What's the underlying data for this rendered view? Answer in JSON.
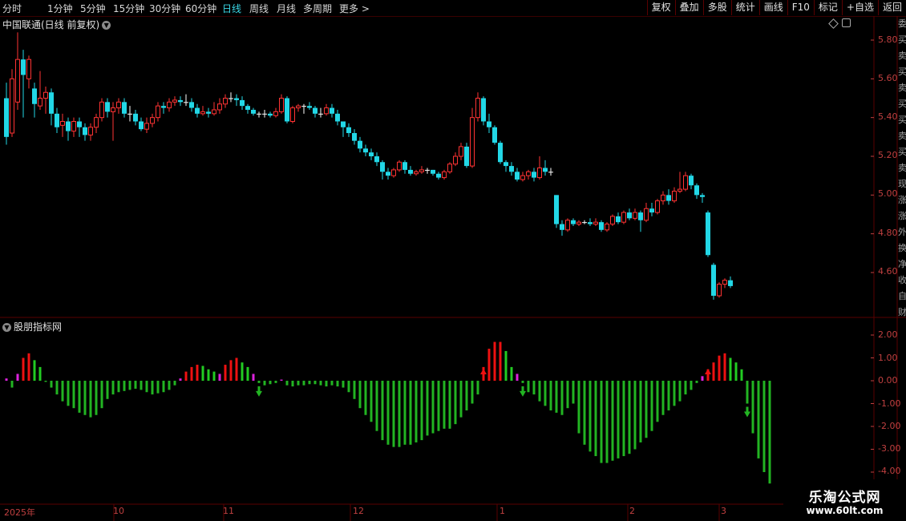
{
  "toolbar": {
    "periods": [
      "分时",
      "1分钟",
      "5分钟",
      "15分钟",
      "30分钟",
      "60分钟",
      "日线",
      "周线",
      "月线",
      "多周期",
      "更多 >"
    ],
    "active_period": "日线",
    "tools": [
      "复权",
      "叠加",
      "多股",
      "统计",
      "画线",
      "F10",
      "标记",
      "+自选",
      "返回"
    ]
  },
  "main_panel": {
    "title": "中国联通(日线 前复权)",
    "price_labels": [
      "5.80",
      "5.60",
      "5.40",
      "5.20",
      "5.00",
      "4.80",
      "4.60"
    ]
  },
  "indicator_panel": {
    "title": "股朋指标网",
    "value_labels": [
      "2.00",
      "1.00",
      "0.00",
      "-1.00",
      "-2.00",
      "-3.00",
      "-4.00"
    ]
  },
  "time_axis": [
    "2025年",
    "10",
    "11",
    "12",
    "1",
    "2",
    "3"
  ],
  "right_strip": [
    "委",
    "买",
    "卖",
    "买",
    "卖",
    "买",
    "买",
    "卖",
    "买",
    "卖",
    "现",
    "涨",
    "涨",
    "外",
    "换",
    "净",
    "收",
    "自",
    "财"
  ],
  "watermark": {
    "line1": "乐淘公式网",
    "line2": "www.60lt.com"
  },
  "colors": {
    "up": "#ff3333",
    "down": "#22d7e6",
    "flat": "#ffffff",
    "positive_bar": "#ee1111",
    "weak_positive_bar": "#22cc22",
    "negative_bar": "#22b422",
    "magenta_bar": "#dd22dd",
    "grid": "#5a0000",
    "axis_text": "#c04040",
    "active": "#3ad7e6"
  },
  "chart_data": [
    {
      "type": "candlestick",
      "title": "中国联通(日线 前复权)",
      "ylim": [
        4.42,
        5.92
      ],
      "candles": [
        [
          5.5,
          5.3,
          5.58,
          5.26
        ],
        [
          5.32,
          5.6,
          5.65,
          5.3
        ],
        [
          5.48,
          5.7,
          5.84,
          5.44
        ],
        [
          5.7,
          5.62,
          5.75,
          5.4
        ],
        [
          5.6,
          5.7,
          5.72,
          5.55
        ],
        [
          5.55,
          5.47,
          5.58,
          5.4
        ],
        [
          5.46,
          5.5,
          5.64,
          5.44
        ],
        [
          5.5,
          5.53,
          5.56,
          5.42
        ],
        [
          5.53,
          5.42,
          5.55,
          5.36
        ],
        [
          5.42,
          5.35,
          5.45,
          5.32
        ],
        [
          5.36,
          5.38,
          5.42,
          5.3
        ],
        [
          5.38,
          5.33,
          5.4,
          5.28
        ],
        [
          5.33,
          5.38,
          5.4,
          5.3
        ],
        [
          5.38,
          5.35,
          5.4,
          5.3
        ],
        [
          5.35,
          5.31,
          5.37,
          5.28
        ],
        [
          5.31,
          5.35,
          5.37,
          5.28
        ],
        [
          5.35,
          5.4,
          5.42,
          5.32
        ],
        [
          5.4,
          5.48,
          5.5,
          5.38
        ],
        [
          5.48,
          5.43,
          5.5,
          5.4
        ],
        [
          5.43,
          5.45,
          5.48,
          5.28
        ],
        [
          5.45,
          5.48,
          5.5,
          5.42
        ],
        [
          5.48,
          5.42,
          5.5,
          5.4
        ],
        [
          5.42,
          5.42,
          5.46,
          5.38
        ],
        [
          5.42,
          5.38,
          5.44,
          5.36
        ],
        [
          5.38,
          5.34,
          5.4,
          5.33
        ],
        [
          5.34,
          5.37,
          5.4,
          5.32
        ],
        [
          5.37,
          5.4,
          5.42,
          5.35
        ],
        [
          5.4,
          5.46,
          5.48,
          5.38
        ],
        [
          5.46,
          5.45,
          5.48,
          5.42
        ],
        [
          5.45,
          5.48,
          5.5,
          5.43
        ],
        [
          5.48,
          5.49,
          5.51,
          5.46
        ],
        [
          5.49,
          5.48,
          5.51,
          5.46
        ],
        [
          5.48,
          5.48,
          5.52,
          5.46
        ],
        [
          5.48,
          5.45,
          5.5,
          5.43
        ],
        [
          5.45,
          5.42,
          5.47,
          5.4
        ],
        [
          5.42,
          5.43,
          5.46,
          5.41
        ],
        [
          5.43,
          5.42,
          5.45,
          5.4
        ],
        [
          5.42,
          5.44,
          5.48,
          5.41
        ],
        [
          5.44,
          5.47,
          5.5,
          5.42
        ],
        [
          5.47,
          5.5,
          5.52,
          5.45
        ],
        [
          5.5,
          5.5,
          5.53,
          5.48
        ],
        [
          5.5,
          5.49,
          5.52,
          5.46
        ],
        [
          5.49,
          5.46,
          5.51,
          5.44
        ],
        [
          5.46,
          5.44,
          5.47,
          5.42
        ],
        [
          5.44,
          5.42,
          5.45,
          5.41
        ],
        [
          5.42,
          5.42,
          5.43,
          5.4
        ],
        [
          5.42,
          5.42,
          5.44,
          5.4
        ],
        [
          5.42,
          5.41,
          5.43,
          5.4
        ],
        [
          5.41,
          5.43,
          5.45,
          5.4
        ],
        [
          5.43,
          5.5,
          5.52,
          5.42
        ],
        [
          5.5,
          5.38,
          5.51,
          5.37
        ],
        [
          5.38,
          5.45,
          5.46,
          5.37
        ],
        [
          5.45,
          5.46,
          5.47,
          5.43
        ],
        [
          5.46,
          5.46,
          5.47,
          5.42
        ],
        [
          5.46,
          5.45,
          5.48,
          5.44
        ],
        [
          5.45,
          5.42,
          5.46,
          5.4
        ],
        [
          5.42,
          5.42,
          5.45,
          5.4
        ],
        [
          5.42,
          5.45,
          5.47,
          5.41
        ],
        [
          5.45,
          5.42,
          5.47,
          5.4
        ],
        [
          5.42,
          5.38,
          5.44,
          5.36
        ],
        [
          5.38,
          5.35,
          5.38,
          5.3
        ],
        [
          5.35,
          5.32,
          5.37,
          5.3
        ],
        [
          5.32,
          5.28,
          5.34,
          5.26
        ],
        [
          5.28,
          5.24,
          5.3,
          5.22
        ],
        [
          5.24,
          5.22,
          5.26,
          5.2
        ],
        [
          5.22,
          5.2,
          5.24,
          5.18
        ],
        [
          5.2,
          5.17,
          5.22,
          5.15
        ],
        [
          5.17,
          5.12,
          5.18,
          5.08
        ],
        [
          5.12,
          5.1,
          5.14,
          5.08
        ],
        [
          5.1,
          5.13,
          5.14,
          5.09
        ],
        [
          5.13,
          5.17,
          5.18,
          5.12
        ],
        [
          5.17,
          5.13,
          5.18,
          5.11
        ],
        [
          5.13,
          5.11,
          5.15,
          5.1
        ],
        [
          5.11,
          5.12,
          5.13,
          5.1
        ],
        [
          5.12,
          5.13,
          5.15,
          5.11
        ],
        [
          5.13,
          5.13,
          5.14,
          5.11
        ],
        [
          5.13,
          5.11,
          5.13,
          5.1
        ],
        [
          5.11,
          5.09,
          5.12,
          5.08
        ],
        [
          5.09,
          5.12,
          5.13,
          5.08
        ],
        [
          5.12,
          5.16,
          5.17,
          5.11
        ],
        [
          5.16,
          5.2,
          5.22,
          5.15
        ],
        [
          5.2,
          5.25,
          5.27,
          5.18
        ],
        [
          5.25,
          5.15,
          5.27,
          5.14
        ],
        [
          5.15,
          5.4,
          5.45,
          5.14
        ],
        [
          5.4,
          5.5,
          5.53,
          5.38
        ],
        [
          5.5,
          5.38,
          5.51,
          5.36
        ],
        [
          5.38,
          5.35,
          5.42,
          5.32
        ],
        [
          5.35,
          5.27,
          5.36,
          5.26
        ],
        [
          5.27,
          5.17,
          5.28,
          5.16
        ],
        [
          5.17,
          5.15,
          5.18,
          5.12
        ],
        [
          5.15,
          5.12,
          5.17,
          5.1
        ],
        [
          5.12,
          5.08,
          5.14,
          5.07
        ],
        [
          5.08,
          5.1,
          5.12,
          5.07
        ],
        [
          5.1,
          5.12,
          5.13,
          5.08
        ],
        [
          5.12,
          5.09,
          5.14,
          5.07
        ],
        [
          5.09,
          5.14,
          5.2,
          5.08
        ],
        [
          5.14,
          5.12,
          5.18,
          5.1
        ],
        [
          5.12,
          5.12,
          5.14,
          5.1
        ],
        [
          5.0,
          4.85,
          5.0,
          4.83
        ],
        [
          4.85,
          4.82,
          4.87,
          4.79
        ],
        [
          4.82,
          4.87,
          4.88,
          4.81
        ],
        [
          4.87,
          4.85,
          4.88,
          4.84
        ],
        [
          4.85,
          4.86,
          4.87,
          4.84
        ],
        [
          4.86,
          4.86,
          4.87,
          4.85
        ],
        [
          4.86,
          4.85,
          4.88,
          4.84
        ],
        [
          4.85,
          4.86,
          4.88,
          4.84
        ],
        [
          4.86,
          4.82,
          4.87,
          4.81
        ],
        [
          4.82,
          4.85,
          4.86,
          4.81
        ],
        [
          4.85,
          4.89,
          4.9,
          4.84
        ],
        [
          4.89,
          4.86,
          4.91,
          4.85
        ],
        [
          4.86,
          4.91,
          4.92,
          4.85
        ],
        [
          4.91,
          4.88,
          4.93,
          4.87
        ],
        [
          4.88,
          4.91,
          4.93,
          4.87
        ],
        [
          4.91,
          4.87,
          4.92,
          4.81
        ],
        [
          4.87,
          4.93,
          4.96,
          4.86
        ],
        [
          4.93,
          4.91,
          4.96,
          4.89
        ],
        [
          4.91,
          4.97,
          4.98,
          4.9
        ],
        [
          4.97,
          5.0,
          5.02,
          4.95
        ],
        [
          5.0,
          4.97,
          5.03,
          4.95
        ],
        [
          4.97,
          5.02,
          5.04,
          4.96
        ],
        [
          5.02,
          5.03,
          5.12,
          5.01
        ],
        [
          5.03,
          5.1,
          5.12,
          5.02
        ],
        [
          5.1,
          5.05,
          5.11,
          5.03
        ],
        [
          5.05,
          5.0,
          5.06,
          4.98
        ],
        [
          5.0,
          4.99,
          5.01,
          4.96
        ],
        [
          4.91,
          4.69,
          4.92,
          4.68
        ],
        [
          4.64,
          4.48,
          4.65,
          4.46
        ],
        [
          4.48,
          4.54,
          4.55,
          4.47
        ],
        [
          4.54,
          4.56,
          4.57,
          4.52
        ],
        [
          4.56,
          4.53,
          4.58,
          4.52
        ]
      ]
    },
    {
      "type": "bar",
      "title": "股朋指标网",
      "ylim": [
        -4.5,
        2.5
      ],
      "values": [
        0.1,
        -0.3,
        0.3,
        1.0,
        1.2,
        0.9,
        0.6,
        -0.05,
        -0.3,
        -0.6,
        -0.9,
        -1.1,
        -1.2,
        -1.4,
        -1.5,
        -1.6,
        -1.5,
        -1.2,
        -0.8,
        -0.6,
        -0.5,
        -0.45,
        -0.4,
        -0.35,
        -0.4,
        -0.5,
        -0.6,
        -0.55,
        -0.5,
        -0.4,
        -0.2,
        0.1,
        0.4,
        0.6,
        0.7,
        0.65,
        0.5,
        0.4,
        0.3,
        0.7,
        0.9,
        1.0,
        0.8,
        0.6,
        0.3,
        -0.1,
        -0.2,
        -0.15,
        -0.1,
        0.05,
        -0.2,
        -0.25,
        -0.2,
        -0.2,
        -0.15,
        -0.15,
        -0.2,
        -0.25,
        -0.2,
        -0.25,
        -0.3,
        -0.5,
        -0.8,
        -1.2,
        -1.5,
        -1.8,
        -2.2,
        -2.6,
        -2.8,
        -2.9,
        -2.9,
        -2.8,
        -2.8,
        -2.7,
        -2.6,
        -2.4,
        -2.3,
        -2.2,
        -2.1,
        -2.1,
        -1.9,
        -1.6,
        -1.3,
        -1.0,
        -0.6,
        0.6,
        1.4,
        1.7,
        1.7,
        1.3,
        0.6,
        0.3,
        -0.1,
        -0.5,
        -0.6,
        -0.9,
        -1.1,
        -1.3,
        -1.4,
        -1.5,
        -1.2,
        -1.0,
        -2.3,
        -2.8,
        -3.1,
        -3.3,
        -3.6,
        -3.6,
        -3.5,
        -3.4,
        -3.3,
        -3.2,
        -3.0,
        -2.7,
        -2.5,
        -2.2,
        -1.8,
        -1.5,
        -1.3,
        -1.1,
        -0.9,
        -0.6,
        -0.4,
        -0.1,
        0.2,
        0.5,
        0.8,
        1.1,
        1.2,
        1.0,
        0.8,
        0.5,
        -1.0,
        -2.3,
        -3.4,
        -4.0,
        -4.5
      ],
      "signals": [
        {
          "index": 45,
          "type": "sell"
        },
        {
          "index": 85,
          "type": "buy"
        },
        {
          "index": 92,
          "type": "sell"
        },
        {
          "index": 125,
          "type": "buy"
        },
        {
          "index": 132,
          "type": "sell"
        }
      ]
    }
  ]
}
